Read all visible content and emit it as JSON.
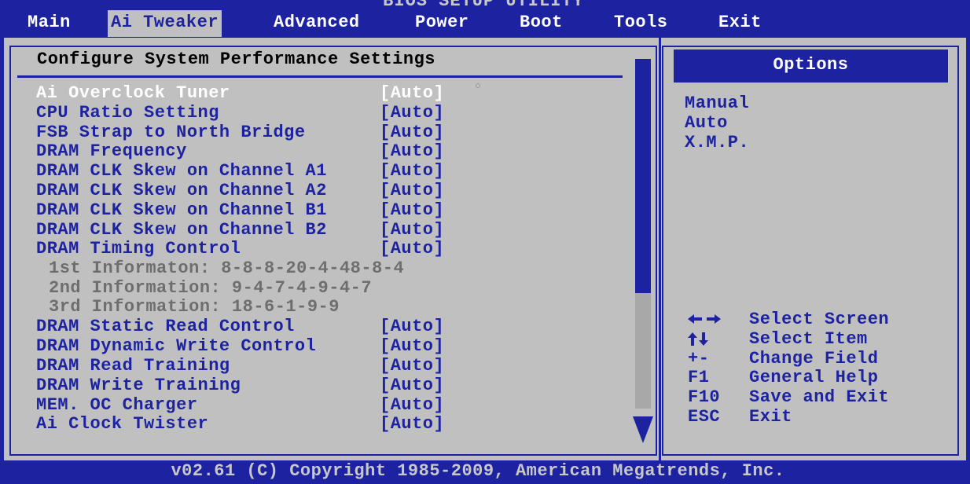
{
  "title": "BIOS SETUP UTILITY",
  "menu": [
    "Main",
    "Ai Tweaker",
    "Advanced",
    "Power",
    "Boot",
    "Tools",
    "Exit"
  ],
  "active_menu": "Ai Tweaker",
  "section_title": "Configure System Performance Settings",
  "settings": [
    {
      "label": "Ai Overclock Tuner",
      "value": "[Auto]",
      "selected": true
    },
    {
      "label": "CPU Ratio Setting",
      "value": "[Auto]"
    },
    {
      "label": "FSB Strap to North Bridge",
      "value": "[Auto]"
    },
    {
      "label": "DRAM Frequency",
      "value": "[Auto]"
    },
    {
      "label": "DRAM CLK Skew on Channel A1",
      "value": "[Auto]"
    },
    {
      "label": "DRAM CLK Skew on Channel A2",
      "value": "[Auto]"
    },
    {
      "label": "DRAM CLK Skew on Channel B1",
      "value": "[Auto]"
    },
    {
      "label": "DRAM CLK Skew on Channel B2",
      "value": "[Auto]"
    },
    {
      "label": "DRAM Timing Control",
      "value": "[Auto]"
    }
  ],
  "timing_info": [
    "1st Informaton: 8-8-8-20-4-48-8-4",
    "2nd Information: 9-4-7-4-9-4-7",
    "3rd Information: 18-6-1-9-9"
  ],
  "settings2": [
    {
      "label": "DRAM Static Read Control",
      "value": "[Auto]"
    },
    {
      "label": "DRAM Dynamic Write Control",
      "value": "[Auto]"
    },
    {
      "label": "DRAM Read Training",
      "value": "[Auto]"
    },
    {
      "label": "DRAM Write Training",
      "value": "[Auto]"
    },
    {
      "label": "MEM. OC Charger",
      "value": "[Auto]"
    },
    {
      "label": "Ai Clock Twister",
      "value": "[Auto]"
    }
  ],
  "options_header": "Options",
  "options": [
    "Manual",
    "Auto",
    "X.M.P."
  ],
  "help": [
    {
      "key": "",
      "icon": "left-right-arrows-icon",
      "action": "Select Screen"
    },
    {
      "key": "",
      "icon": "up-down-arrows-icon",
      "action": "Select Item"
    },
    {
      "key": "+-",
      "action": "Change Field"
    },
    {
      "key": "F1",
      "action": "General Help"
    },
    {
      "key": "F10",
      "action": "Save and Exit"
    },
    {
      "key": "ESC",
      "action": "Exit"
    }
  ],
  "footer": "v02.61 (C) Copyright 1985-2009, American Megatrends, Inc.",
  "colors": {
    "bios_blue": "#1d23a0",
    "panel_gray": "#c0c0c0",
    "selected_text": "#ffffff"
  }
}
